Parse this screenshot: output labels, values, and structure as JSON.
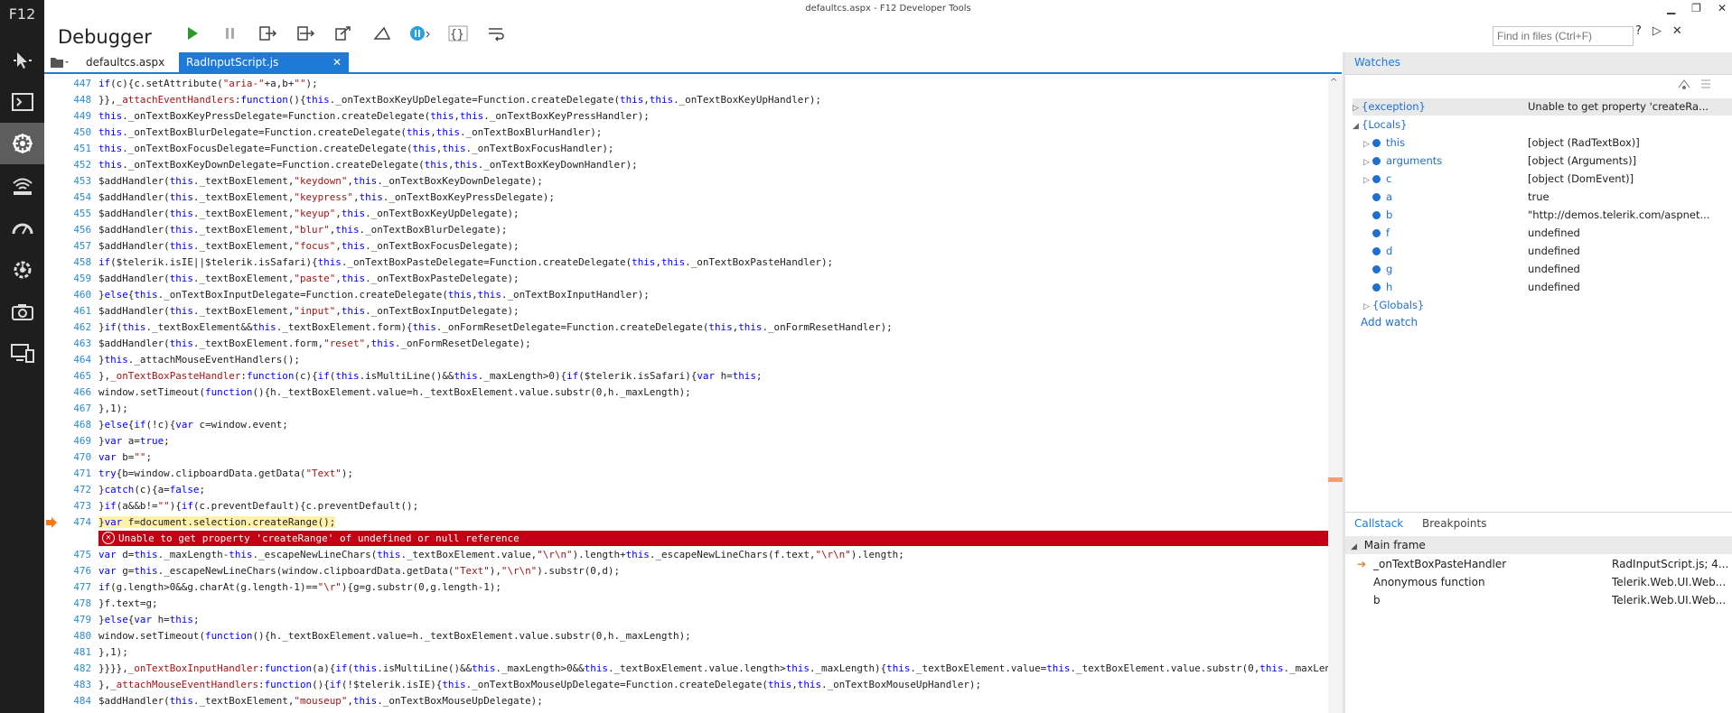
{
  "window_title": "defaultcs.aspx - F12 Developer Tools",
  "app": {
    "f12_label": "F12",
    "tool_title": "Debugger"
  },
  "find": {
    "placeholder": "Find in files (Ctrl+F)"
  },
  "top_icons": [
    "?",
    "▷",
    "✕"
  ],
  "tabs": [
    {
      "label": "defaultcs.aspx"
    },
    {
      "label": "RadInputScript.js"
    }
  ],
  "code": {
    "lines": [
      {
        "n": "447",
        "t": "if(c){c.setAttribute(\"aria-\"+a,b+\"\");"
      },
      {
        "n": "448",
        "t": "}},_attachEventHandlers:function(){this._onTextBoxKeyUpDelegate=Function.createDelegate(this,this._onTextBoxKeyUpHandler);"
      },
      {
        "n": "449",
        "t": "this._onTextBoxKeyPressDelegate=Function.createDelegate(this,this._onTextBoxKeyPressHandler);"
      },
      {
        "n": "450",
        "t": "this._onTextBoxBlurDelegate=Function.createDelegate(this,this._onTextBoxBlurHandler);"
      },
      {
        "n": "451",
        "t": "this._onTextBoxFocusDelegate=Function.createDelegate(this,this._onTextBoxFocusHandler);"
      },
      {
        "n": "452",
        "t": "this._onTextBoxKeyDownDelegate=Function.createDelegate(this,this._onTextBoxKeyDownHandler);"
      },
      {
        "n": "453",
        "t": "$addHandler(this._textBoxElement,\"keydown\",this._onTextBoxKeyDownDelegate);"
      },
      {
        "n": "454",
        "t": "$addHandler(this._textBoxElement,\"keypress\",this._onTextBoxKeyPressDelegate);"
      },
      {
        "n": "455",
        "t": "$addHandler(this._textBoxElement,\"keyup\",this._onTextBoxKeyUpDelegate);"
      },
      {
        "n": "456",
        "t": "$addHandler(this._textBoxElement,\"blur\",this._onTextBoxBlurDelegate);"
      },
      {
        "n": "457",
        "t": "$addHandler(this._textBoxElement,\"focus\",this._onTextBoxFocusDelegate);"
      },
      {
        "n": "458",
        "t": "if($telerik.isIE||$telerik.isSafari){this._onTextBoxPasteDelegate=Function.createDelegate(this,this._onTextBoxPasteHandler);"
      },
      {
        "n": "459",
        "t": "$addHandler(this._textBoxElement,\"paste\",this._onTextBoxPasteDelegate);"
      },
      {
        "n": "460",
        "t": "}else{this._onTextBoxInputDelegate=Function.createDelegate(this,this._onTextBoxInputHandler);"
      },
      {
        "n": "461",
        "t": "$addHandler(this._textBoxElement,\"input\",this._onTextBoxInputDelegate);"
      },
      {
        "n": "462",
        "t": "}if(this._textBoxElement&&this._textBoxElement.form){this._onFormResetDelegate=Function.createDelegate(this,this._onFormResetHandler);"
      },
      {
        "n": "463",
        "t": "$addHandler(this._textBoxElement.form,\"reset\",this._onFormResetDelegate);"
      },
      {
        "n": "464",
        "t": "}this._attachMouseEventHandlers();"
      },
      {
        "n": "465",
        "t": "},_onTextBoxPasteHandler:function(c){if(this.isMultiLine()&&this._maxLength>0){if($telerik.isSafari){var h=this;"
      },
      {
        "n": "466",
        "t": "window.setTimeout(function(){h._textBoxElement.value=h._textBoxElement.value.substr(0,h._maxLength);"
      },
      {
        "n": "467",
        "t": "},1);"
      },
      {
        "n": "468",
        "t": "}else{if(!c){var c=window.event;"
      },
      {
        "n": "469",
        "t": "}var a=true;"
      },
      {
        "n": "470",
        "t": "var b=\"\";"
      },
      {
        "n": "471",
        "t": "try{b=window.clipboardData.getData(\"Text\");"
      },
      {
        "n": "472",
        "t": "}catch(c){a=false;"
      },
      {
        "n": "473",
        "t": "}if(a&&b!=\"\"){if(c.preventDefault){c.preventDefault();"
      },
      {
        "n": "474",
        "t": "}var f=document.selection.createRange();",
        "current": true
      },
      {
        "n": "475",
        "t": "var d=this._maxLength-this._escapeNewLineChars(this._textBoxElement.value,\"\\r\\n\").length+this._escapeNewLineChars(f.text,\"\\r\\n\").length;"
      },
      {
        "n": "476",
        "t": "var g=this._escapeNewLineChars(window.clipboardData.getData(\"Text\"),\"\\r\\n\").substr(0,d);"
      },
      {
        "n": "477",
        "t": "if(g.length>0&&g.charAt(g.length-1)==\"\\r\"){g=g.substr(0,g.length-1);"
      },
      {
        "n": "478",
        "t": "}f.text=g;"
      },
      {
        "n": "479",
        "t": "}else{var h=this;"
      },
      {
        "n": "480",
        "t": "window.setTimeout(function(){h._textBoxElement.value=h._textBoxElement.value.substr(0,h._maxLength);"
      },
      {
        "n": "481",
        "t": "},1);"
      },
      {
        "n": "482",
        "t": "}}}},_onTextBoxInputHandler:function(a){if(this.isMultiLine()&&this._maxLength>0&&this._textBoxElement.value.length>this._maxLength){this._textBoxElement.value=this._textBoxElement.value.substr(0,this._maxLen"
      },
      {
        "n": "483",
        "t": "},_attachMouseEventHandlers:function(){if(!$telerik.isIE){this._onTextBoxMouseUpDelegate=Function.createDelegate(this,this._onTextBoxMouseUpHandler);"
      },
      {
        "n": "484",
        "t": "$addHandler(this._textBoxElement,\"mouseup\",this._onTextBoxMouseUpDelegate);"
      }
    ],
    "error_message": "Unable to get property 'createRange' of undefined or null reference"
  },
  "watches": {
    "title": "Watches",
    "items": [
      {
        "name": "{exception}",
        "value": "Unable to get property 'createRa...",
        "indent": 0,
        "expander": "▷",
        "icon": false
      },
      {
        "name": "{Locals}",
        "value": "",
        "indent": 0,
        "expander": "◢",
        "icon": false
      },
      {
        "name": "this",
        "value": "[object (RadTextBox)]",
        "indent": 1,
        "expander": "▷",
        "icon": true
      },
      {
        "name": "arguments",
        "value": "[object (Arguments)]",
        "indent": 1,
        "expander": "▷",
        "icon": true
      },
      {
        "name": "c",
        "value": "[object (DomEvent)]",
        "indent": 1,
        "expander": "▷",
        "icon": true
      },
      {
        "name": "a",
        "value": "true",
        "indent": 1,
        "expander": "",
        "icon": true
      },
      {
        "name": "b",
        "value": "\"http://demos.telerik.com/aspnet...",
        "indent": 1,
        "expander": "",
        "icon": true
      },
      {
        "name": "f",
        "value": "undefined",
        "indent": 1,
        "expander": "",
        "icon": true
      },
      {
        "name": "d",
        "value": "undefined",
        "indent": 1,
        "expander": "",
        "icon": true
      },
      {
        "name": "g",
        "value": "undefined",
        "indent": 1,
        "expander": "",
        "icon": true
      },
      {
        "name": "h",
        "value": "undefined",
        "indent": 1,
        "expander": "",
        "icon": true
      },
      {
        "name": "{Globals}",
        "value": "",
        "indent": 1,
        "expander": "▷",
        "icon": false
      }
    ],
    "add_watch": "Add watch"
  },
  "callstack": {
    "tab_label": "Callstack",
    "breakpoints_label": "Breakpoints",
    "frame_group": "Main frame",
    "frames": [
      {
        "name": "_onTextBoxPasteHandler",
        "location": "RadInputScript.js; 4...",
        "current": true
      },
      {
        "name": "Anonymous function",
        "location": "Telerik.Web.UI.Web...",
        "current": false
      },
      {
        "name": "b",
        "location": "Telerik.Web.UI.Web...",
        "current": false
      }
    ]
  },
  "colors": {
    "accent": "#1e7ad7",
    "error": "#c30013",
    "rail": "#1e1e1e",
    "current_line": "#fff2a8",
    "pointer": "#f07a1c"
  }
}
